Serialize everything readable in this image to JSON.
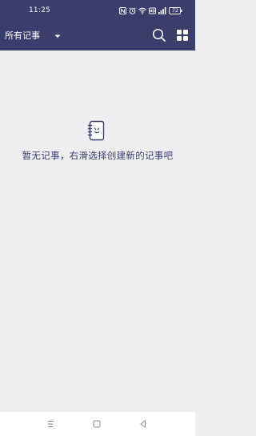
{
  "status_bar": {
    "time": "11:25",
    "battery": "72",
    "icons": [
      "nfc-icon",
      "alarm-icon",
      "wifi-icon",
      "hd-icon",
      "signal-icon",
      "battery-icon"
    ]
  },
  "app_bar": {
    "filter_label": "所有记事",
    "background": "#3b3d6b",
    "icons": [
      "search-icon",
      "grid-view-icon"
    ]
  },
  "empty_state": {
    "message": "暂无记事，右滑选择创建新的记事吧",
    "icon": "notebook-smile-icon",
    "text_color": "#3b3d6b"
  },
  "nav_bar": {
    "icons": [
      "menu-icon",
      "home-icon",
      "back-icon"
    ]
  }
}
